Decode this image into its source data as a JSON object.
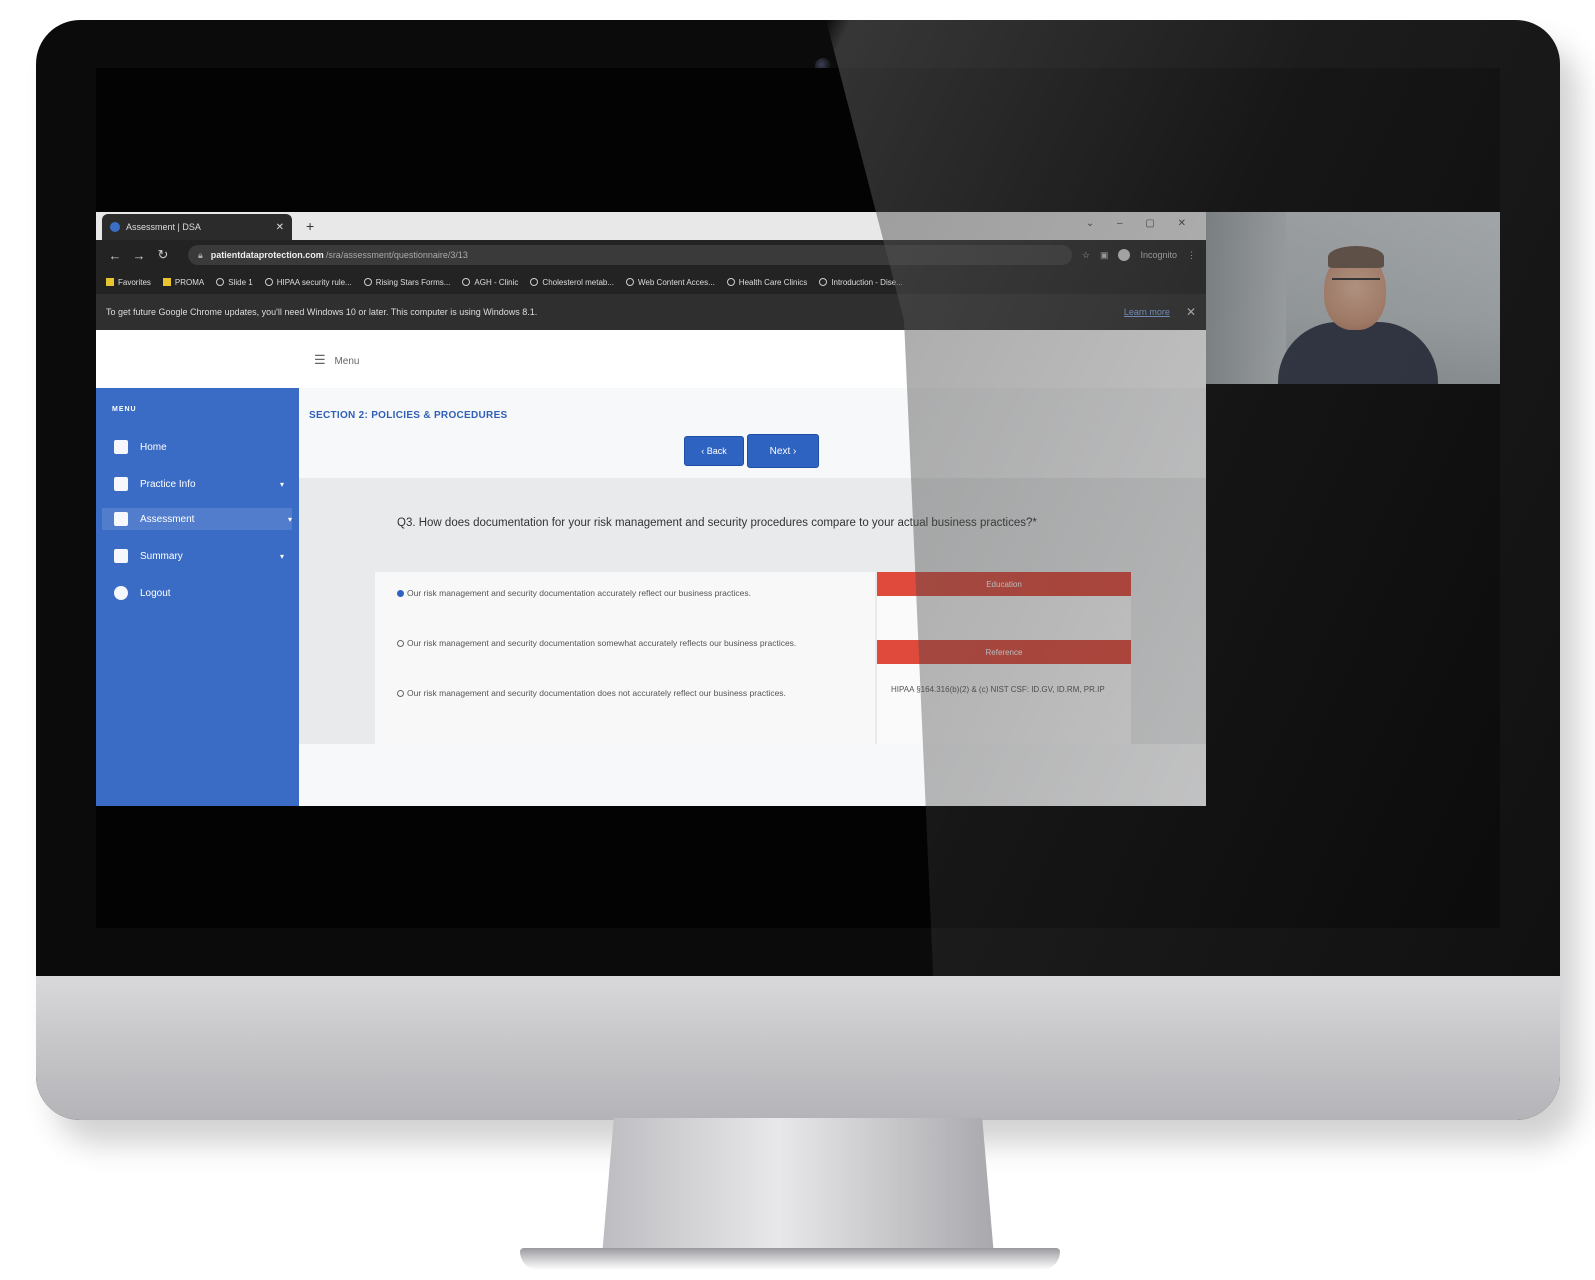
{
  "browser": {
    "tab_title": "Assessment | DSA",
    "new_tab": "+",
    "window_controls": "⌄ – ▢ ✕",
    "url_domain": "patientdataprotection.com",
    "url_path": "/sra/assessment/questionnaire/3/13",
    "incognito_label": "Incognito",
    "bookmarks": [
      "Favorites",
      "PROMA",
      "Slide 1",
      "HIPAA security rule...",
      "Rising Stars Forms...",
      "AGH - Clinic",
      "Cholesterol metab...",
      "Web Content Acces...",
      "Health Care Clinics",
      "Introduction - Dise..."
    ],
    "infobar_text": "To get future Google Chrome updates, you'll need Windows 10 or later. This computer is using Windows 8.1.",
    "infobar_link": "Learn more",
    "infobar_close": "✕"
  },
  "app": {
    "menu_toggle": "Menu",
    "sidebar": {
      "title": "MENU",
      "items": [
        {
          "label": "Home",
          "icon": "home-icon"
        },
        {
          "label": "Practice Info",
          "icon": "building-icon"
        },
        {
          "label": "Assessment",
          "icon": "clipboard-icon"
        },
        {
          "label": "Summary",
          "icon": "clipboard-icon"
        },
        {
          "label": "Logout",
          "icon": "gear-icon"
        }
      ]
    },
    "section_title": "SECTION 2: POLICIES & PROCEDURES",
    "back_button": "‹ Back",
    "next_button": "Next ›",
    "question": "Q3. How does documentation for your risk management and security procedures compare to your actual business practices?*",
    "answers": [
      {
        "text": "Our risk management and security documentation accurately reflect our business practices.",
        "selected": true
      },
      {
        "text": "Our risk management and security documentation somewhat accurately reflects our business practices.",
        "selected": false
      },
      {
        "text": "Our risk management and security documentation does not accurately reflect our business practices.",
        "selected": false
      }
    ],
    "education_label": "Education",
    "reference_label": "Reference",
    "reference_text": "HIPAA §164.316(b)(2) & (c) NIST CSF: ID.GV, ID.RM, PR.IP"
  },
  "colors": {
    "sidebar_blue": "#3a6bc5",
    "button_blue": "#2f63c2",
    "accent_red": "#e04a3c"
  }
}
